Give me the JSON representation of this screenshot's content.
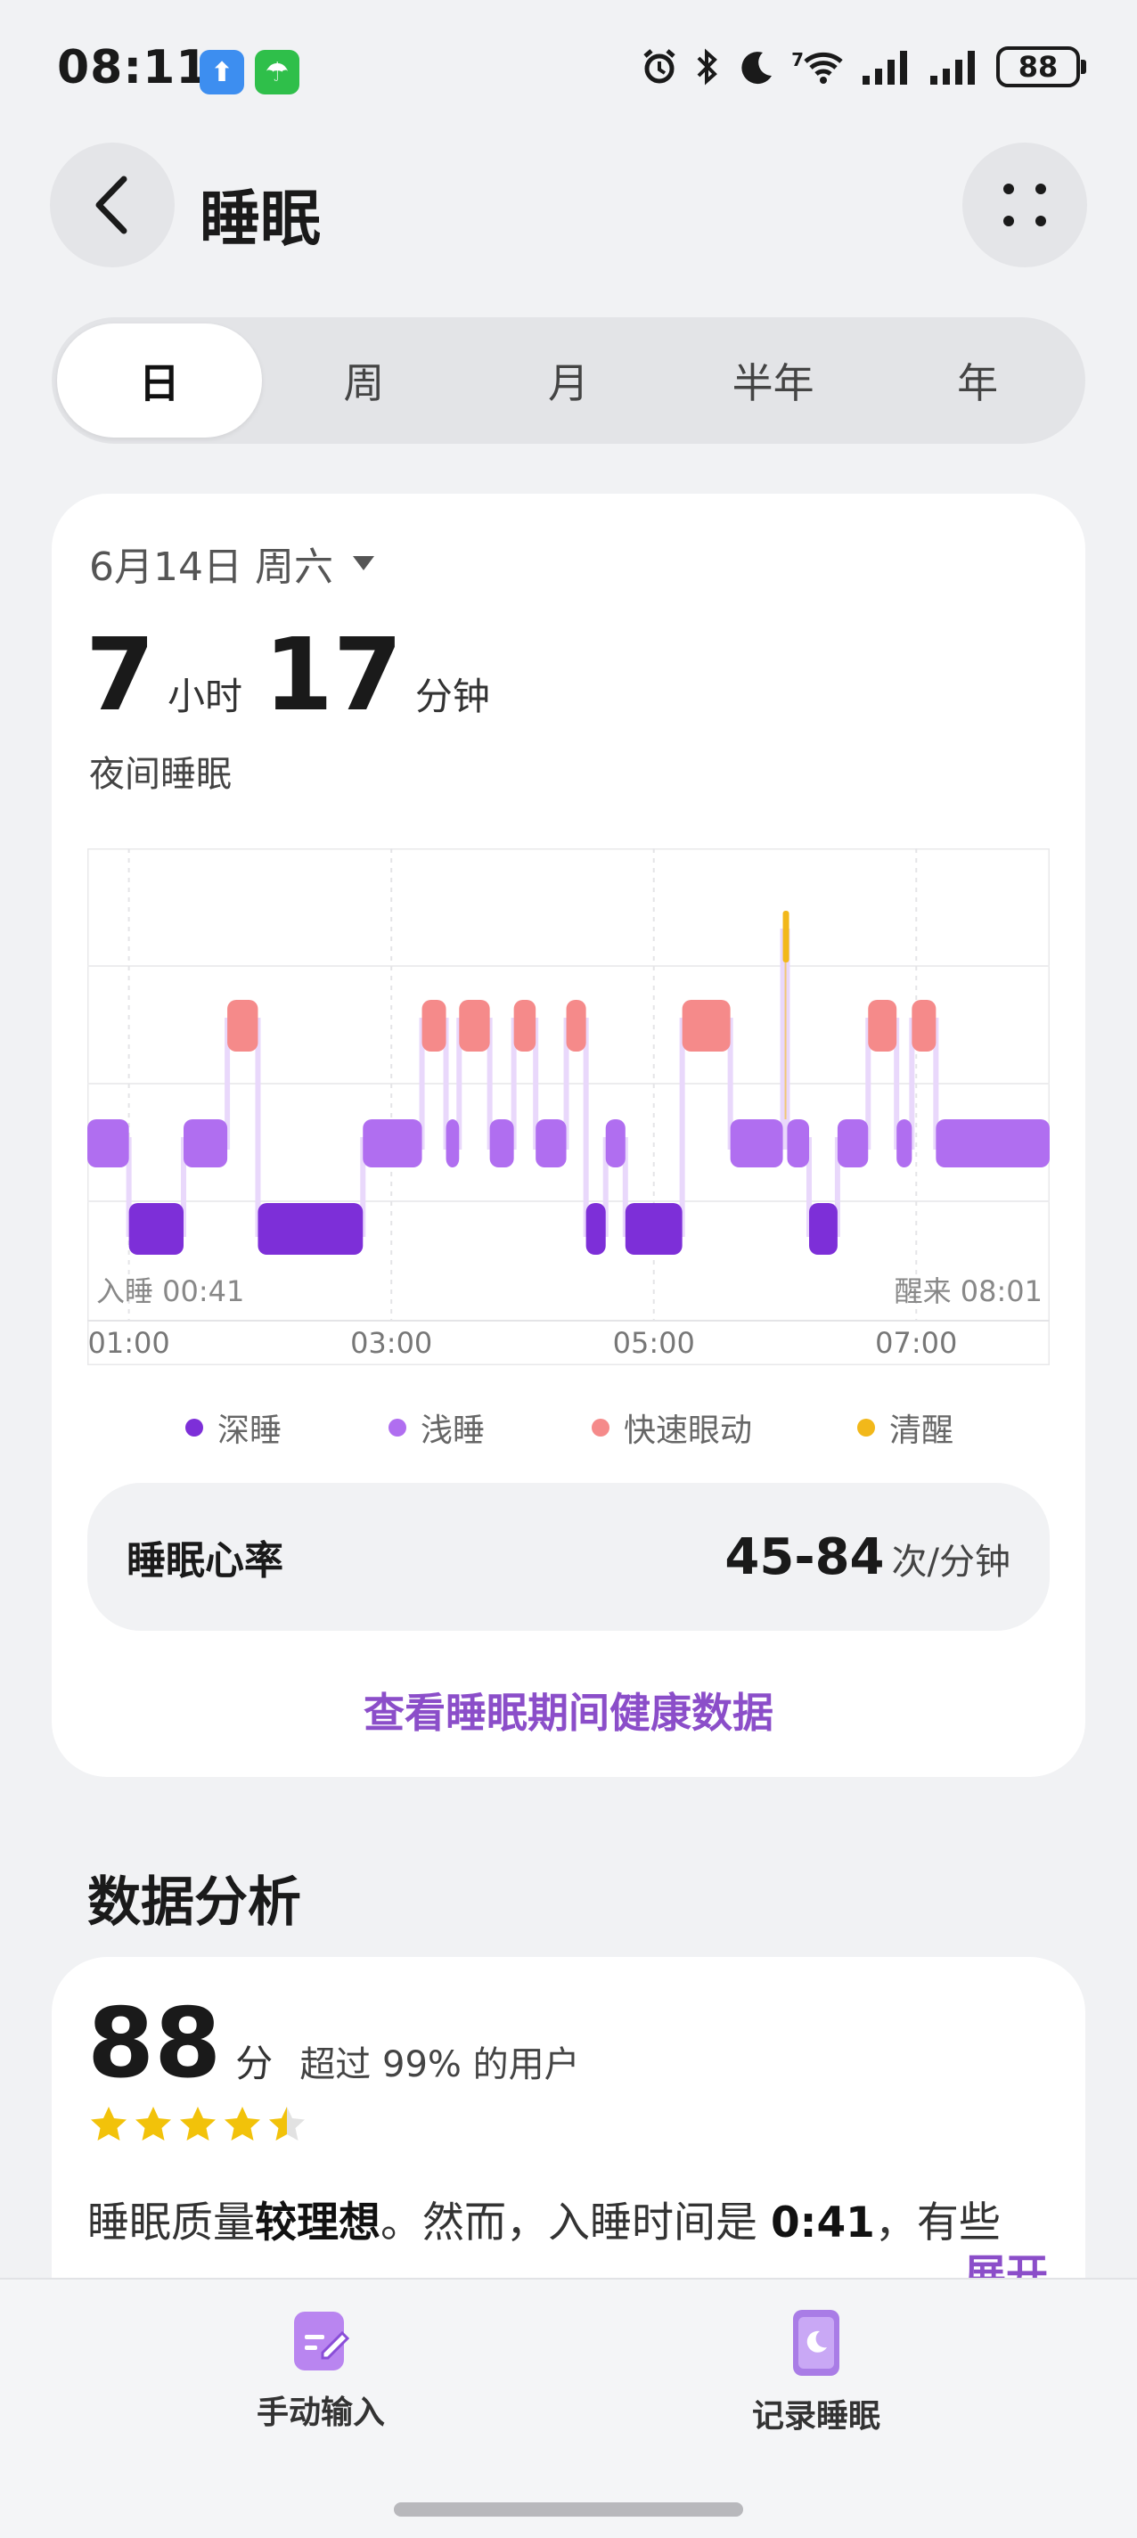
{
  "status": {
    "time": "08:11",
    "battery": "88",
    "net_badge": "7"
  },
  "header": {
    "title": "睡眠"
  },
  "tabs": [
    "日",
    "周",
    "月",
    "半年",
    "年"
  ],
  "sleep_card": {
    "date": "6月14日 周六",
    "hours": "7",
    "hours_unit": "小时",
    "minutes": "17",
    "minutes_unit": "分钟",
    "label": "夜间睡眠",
    "heart_rate_title": "睡眠心率",
    "heart_rate_value": "45-84",
    "heart_rate_unit": "次/分钟",
    "link": "查看睡眠期间健康数据"
  },
  "legend": [
    {
      "label": "深睡",
      "color": "#7d2fd8"
    },
    {
      "label": "浅睡",
      "color": "#b06ef0"
    },
    {
      "label": "快速眼动",
      "color": "#f58a8a"
    },
    {
      "label": "清醒",
      "color": "#f2b81a"
    }
  ],
  "chart_data": {
    "type": "sleep-stage-timeline",
    "sleep_start_label": "入睡 00:41",
    "wake_label": "醒来 08:01",
    "x_ticks": [
      "01:00",
      "03:00",
      "05:00",
      "07:00"
    ],
    "x_range": [
      "00:41",
      "08:01"
    ],
    "stages": [
      "清醒",
      "快速眼动",
      "浅睡",
      "深睡"
    ],
    "segments": [
      {
        "stage": "浅睡",
        "start": "00:41",
        "end": "01:00"
      },
      {
        "stage": "深睡",
        "start": "01:00",
        "end": "01:25"
      },
      {
        "stage": "浅睡",
        "start": "01:25",
        "end": "01:45"
      },
      {
        "stage": "快速眼动",
        "start": "01:45",
        "end": "01:59"
      },
      {
        "stage": "深睡",
        "start": "01:59",
        "end": "02:47"
      },
      {
        "stage": "浅睡",
        "start": "02:47",
        "end": "03:14"
      },
      {
        "stage": "快速眼动",
        "start": "03:14",
        "end": "03:25"
      },
      {
        "stage": "浅睡",
        "start": "03:25",
        "end": "03:31"
      },
      {
        "stage": "快速眼动",
        "start": "03:31",
        "end": "03:45"
      },
      {
        "stage": "浅睡",
        "start": "03:45",
        "end": "03:56"
      },
      {
        "stage": "快速眼动",
        "start": "03:56",
        "end": "04:06"
      },
      {
        "stage": "浅睡",
        "start": "04:06",
        "end": "04:20"
      },
      {
        "stage": "快速眼动",
        "start": "04:20",
        "end": "04:29"
      },
      {
        "stage": "深睡",
        "start": "04:29",
        "end": "04:38"
      },
      {
        "stage": "浅睡",
        "start": "04:38",
        "end": "04:47"
      },
      {
        "stage": "深睡",
        "start": "04:47",
        "end": "05:13"
      },
      {
        "stage": "快速眼动",
        "start": "05:13",
        "end": "05:35"
      },
      {
        "stage": "浅睡",
        "start": "05:35",
        "end": "05:59"
      },
      {
        "stage": "清醒",
        "start": "05:59",
        "end": "06:01"
      },
      {
        "stage": "浅睡",
        "start": "06:01",
        "end": "06:11"
      },
      {
        "stage": "深睡",
        "start": "06:11",
        "end": "06:24"
      },
      {
        "stage": "浅睡",
        "start": "06:24",
        "end": "06:38"
      },
      {
        "stage": "快速眼动",
        "start": "06:38",
        "end": "06:51"
      },
      {
        "stage": "浅睡",
        "start": "06:51",
        "end": "06:58"
      },
      {
        "stage": "快速眼动",
        "start": "06:58",
        "end": "07:09"
      },
      {
        "stage": "浅睡",
        "start": "07:09",
        "end": "08:01"
      }
    ]
  },
  "analysis": {
    "title": "数据分析",
    "score": "88",
    "score_unit": "分",
    "beat_text": "超过 99% 的用户",
    "stars": 4.5,
    "text_part1": "睡眠质量",
    "text_bold1": "较理想",
    "text_part2": "。然而，入睡时间是 ",
    "text_bold2": "0:41",
    "text_part3": "，有些晚，晚睡可能导致免疫力下降，容易引发...",
    "expand": "展开"
  },
  "bottom_bar": {
    "manual_input": "手动输入",
    "record_sleep": "记录睡眠"
  },
  "colors": {
    "accent": "#8b4ec9",
    "deep": "#7d2fd8",
    "light": "#b06ef0",
    "rem": "#f58a8a",
    "awake": "#f2b81a"
  }
}
